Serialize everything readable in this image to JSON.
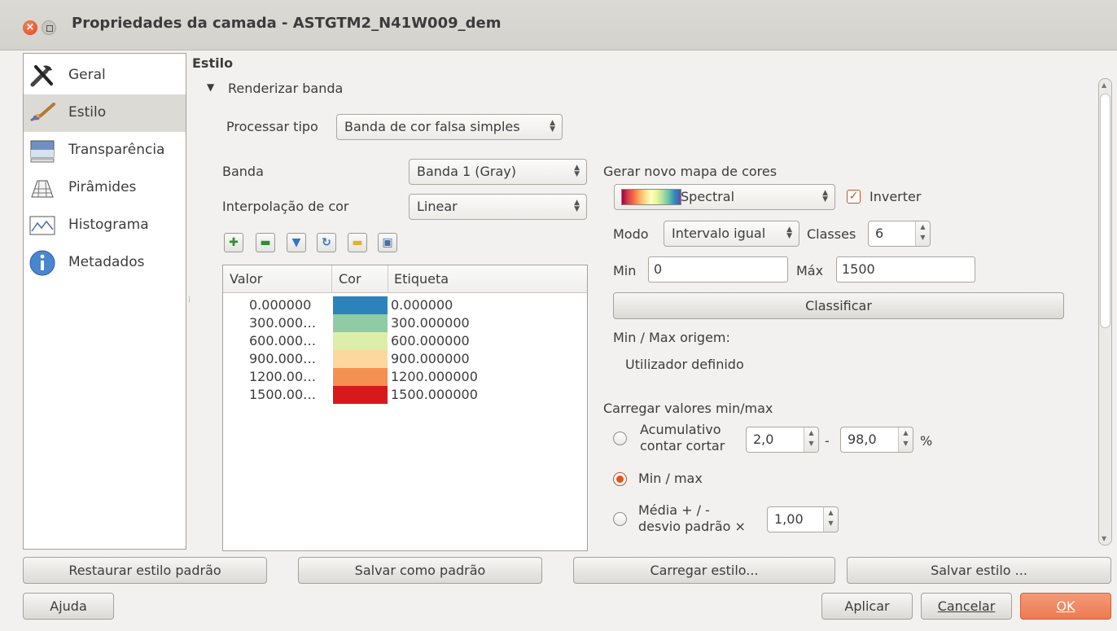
{
  "window": {
    "title": "Propriedades da camada - ASTGTM2_N41W009_dem"
  },
  "sidebar": {
    "items": [
      {
        "label": "Geral",
        "icon": "tools-icon"
      },
      {
        "label": "Estilo",
        "icon": "paintbrush-icon"
      },
      {
        "label": "Transparência",
        "icon": "transparency-icon"
      },
      {
        "label": "Pirâmides",
        "icon": "pyramids-icon"
      },
      {
        "label": "Histograma",
        "icon": "histogram-icon"
      },
      {
        "label": "Metadados",
        "icon": "info-icon"
      }
    ],
    "selected": "Estilo"
  },
  "style": {
    "section_title": "Estilo",
    "group_title": "Renderizar banda",
    "render_type_label": "Processar tipo",
    "render_type_value": "Banda de cor falsa simples",
    "band_label": "Banda",
    "band_value": "Banda 1 (Gray)",
    "interp_label": "Interpolação de cor",
    "interp_value": "Linear",
    "toolbar_icons": [
      "add-icon",
      "remove-icon",
      "sort-icon",
      "refresh-icon",
      "open-folder-icon",
      "save-icon"
    ],
    "table": {
      "headers": [
        "Valor",
        "Cor",
        "Etiqueta"
      ],
      "rows": [
        {
          "value": "0.000000",
          "color": "#2b83ba",
          "label": "0.000000"
        },
        {
          "value": "300.000…",
          "color": "#8fcca6",
          "label": "300.000000"
        },
        {
          "value": "600.000…",
          "color": "#dcefaa",
          "label": "600.000000"
        },
        {
          "value": "900.000…",
          "color": "#fdd89e",
          "label": "900.000000"
        },
        {
          "value": "1200.00…",
          "color": "#f59053",
          "label": "1200.000000"
        },
        {
          "value": "1500.00…",
          "color": "#d7191c",
          "label": "1500.000000"
        }
      ]
    }
  },
  "colormap": {
    "title": "Gerar novo mapa de cores",
    "ramp_value": "Spectral",
    "invert_label": "Inverter",
    "invert_checked": true,
    "mode_label": "Modo",
    "mode_value": "Intervalo igual",
    "classes_label": "Classes",
    "classes_value": "6",
    "min_label": "Min",
    "min_value": "0",
    "max_label": "Máx",
    "max_value": "1500",
    "classify_label": "Classificar",
    "origin_label": "Min / Max origem:",
    "origin_value": "Utilizador definido"
  },
  "minmax": {
    "title": "Carregar valores min/max",
    "cumulative_label_1": "Acumulativo",
    "cumulative_label_2": "contar cortar",
    "cumulative_low": "2,0",
    "dash": "-",
    "cumulative_high": "98,0",
    "percent": "%",
    "minmax_label": "Min / max",
    "stddev_label_1": "Média + / -",
    "stddev_label_2": "desvio padrão ×",
    "stddev_value": "1,00",
    "selected": "Min / max"
  },
  "bottom_buttons": {
    "restore": "Restaurar estilo padrão",
    "save_default": "Salvar como padrão",
    "load_style": "Carregar estilo...",
    "save_style": "Salvar estilo ...",
    "help": "Ajuda",
    "apply": "Aplicar",
    "cancel": "Cancelar",
    "ok": "OK"
  },
  "colors": {
    "accent": "#ed7b51",
    "selected_sidebar": "#dcdad5"
  }
}
